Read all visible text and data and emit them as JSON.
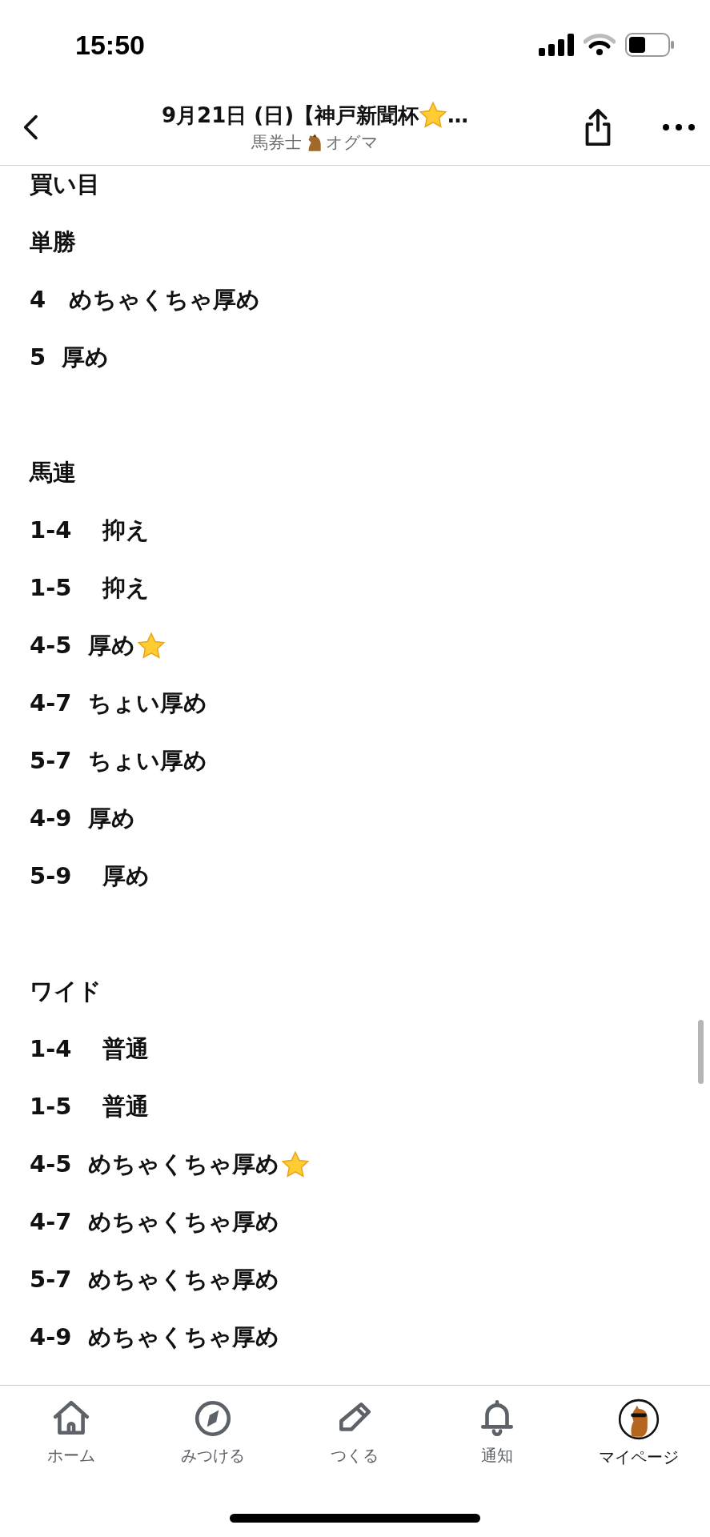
{
  "status_bar": {
    "time": "15:50"
  },
  "nav": {
    "title": "9月21日 (日)【神戸新聞杯",
    "title_star": true,
    "title_suffix": "…",
    "author_prefix": "馬券士",
    "author_name": "オグマ"
  },
  "content": {
    "heading": "買い目",
    "sections": [
      {
        "title": "単勝",
        "items": [
          {
            "text": "4　めちゃくちゃ厚め",
            "star": false
          },
          {
            "text": "5  厚め",
            "star": false
          }
        ]
      },
      {
        "title": "馬連",
        "items": [
          {
            "text": "1-4　 抑え",
            "star": false
          },
          {
            "text": "1-5　 抑え",
            "star": false
          },
          {
            "text": "4-5  厚め",
            "star": true
          },
          {
            "text": "4-7  ちょい厚め",
            "star": false
          },
          {
            "text": "5-7  ちょい厚め",
            "star": false
          },
          {
            "text": "4-9  厚め",
            "star": false
          },
          {
            "text": "5-9　 厚め",
            "star": false
          }
        ]
      },
      {
        "title": "ワイド",
        "items": [
          {
            "text": "1-4　 普通",
            "star": false
          },
          {
            "text": "1-5　 普通",
            "star": false
          },
          {
            "text": "4-5  めちゃくちゃ厚め",
            "star": true
          },
          {
            "text": "4-7  めちゃくちゃ厚め",
            "star": false
          },
          {
            "text": "5-7  めちゃくちゃ厚め",
            "star": false
          },
          {
            "text": "4-9  めちゃくちゃ厚め",
            "star": false
          }
        ]
      }
    ]
  },
  "tabs": [
    {
      "kind": "home",
      "label": "ホーム",
      "selected": false
    },
    {
      "kind": "discover",
      "label": "みつける",
      "selected": false
    },
    {
      "kind": "create",
      "label": "つくる",
      "selected": false
    },
    {
      "kind": "bell",
      "label": "通知",
      "selected": false
    },
    {
      "kind": "avatar",
      "label": "マイページ",
      "selected": true
    }
  ]
}
